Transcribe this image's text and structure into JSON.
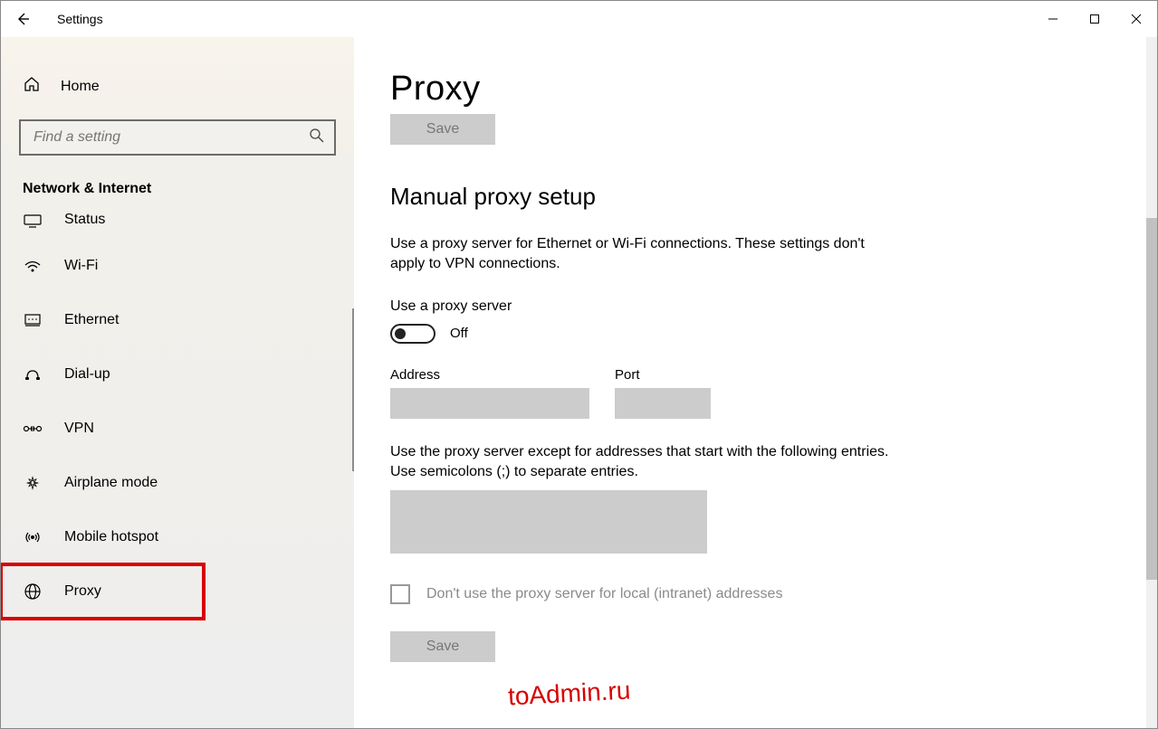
{
  "titlebar": {
    "app_title": "Settings"
  },
  "sidebar": {
    "home_label": "Home",
    "search_placeholder": "Find a setting",
    "category_title": "Network & Internet",
    "items": [
      {
        "label": "Status",
        "icon": "status-icon"
      },
      {
        "label": "Wi-Fi",
        "icon": "wifi-icon"
      },
      {
        "label": "Ethernet",
        "icon": "ethernet-icon"
      },
      {
        "label": "Dial-up",
        "icon": "dialup-icon"
      },
      {
        "label": "VPN",
        "icon": "vpn-icon"
      },
      {
        "label": "Airplane mode",
        "icon": "airplane-icon"
      },
      {
        "label": "Mobile hotspot",
        "icon": "hotspot-icon"
      },
      {
        "label": "Proxy",
        "icon": "globe-icon"
      }
    ]
  },
  "main": {
    "page_title": "Proxy",
    "save_top_label": "Save",
    "section_title": "Manual proxy setup",
    "section_desc": "Use a proxy server for Ethernet or Wi-Fi connections. These settings don't apply to VPN connections.",
    "use_proxy_label": "Use a proxy server",
    "toggle_state_label": "Off",
    "address_label": "Address",
    "address_value": "",
    "port_label": "Port",
    "port_value": "",
    "except_desc": "Use the proxy server except for addresses that start with the following entries. Use semicolons (;) to separate entries.",
    "except_value": "",
    "local_checkbox_label": "Don't use the proxy server for local (intranet) addresses",
    "save_bottom_label": "Save"
  },
  "watermark": "toAdmin.ru"
}
